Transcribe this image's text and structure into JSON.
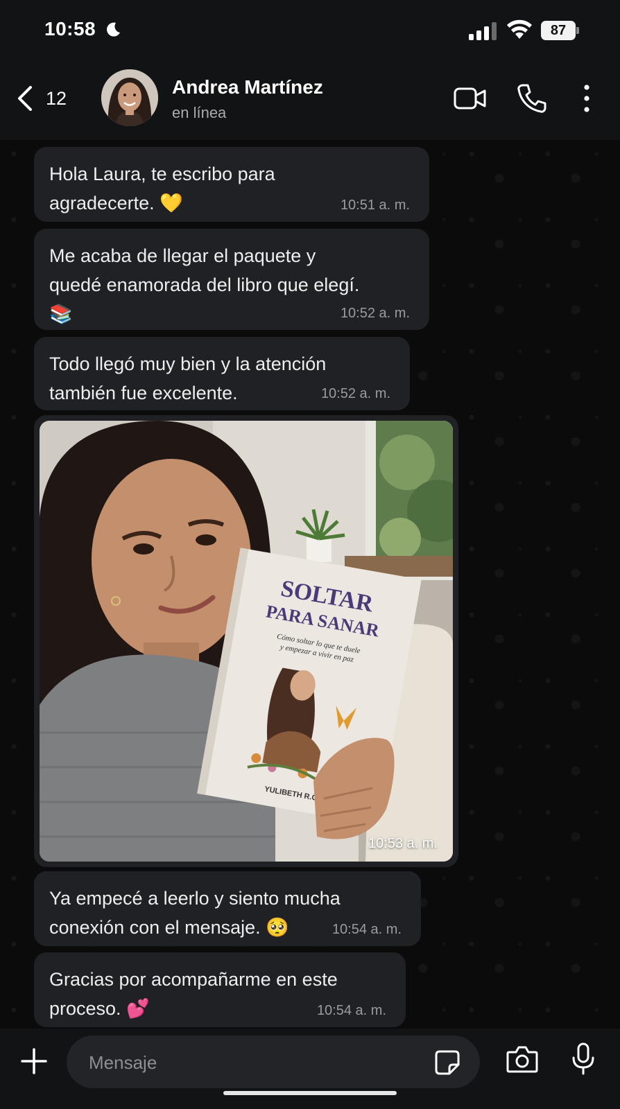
{
  "status_bar": {
    "time": "10:58",
    "battery": "87",
    "icons": [
      "moon-icon",
      "signal-icon",
      "wifi-icon",
      "battery-icon"
    ]
  },
  "header": {
    "back_count": "12",
    "contact_name": "Andrea Martínez",
    "contact_status": "en línea",
    "icons": [
      "chevron-left-icon",
      "video-camera-icon",
      "phone-icon",
      "more-vertical-icon"
    ]
  },
  "messages": [
    {
      "text": "Hola Laura, te escribo para\nagradecerte. 💛",
      "time": "10:51 a. m."
    },
    {
      "text": "Me acaba de llegar el paquete y\nquedé enamorada del libro que elegí.\n📚",
      "time": "10:52 a. m."
    },
    {
      "text": "Todo llegó muy bien y la atención\ntambién fue excelente.",
      "time": "10:52 a. m."
    },
    {
      "text": "Ya empecé a leerlo y siento mucha\nconexión con el mensaje. 🥺",
      "time": "10:54 a. m."
    },
    {
      "text": "Gracias por acompañarme en este\nproceso. 💕",
      "time": "10:54 a. m."
    }
  ],
  "photo_message": {
    "time": "10:53 a. m.",
    "book": {
      "title_line1": "SOLTAR",
      "title_line2": "PARA SANAR",
      "subtitle_line1": "Cómo soltar lo que te duele",
      "subtitle_line2": "y empezar a vivir en paz",
      "author": "YULIBETH R.G."
    }
  },
  "input_bar": {
    "placeholder": "Mensaje",
    "icons": [
      "plus-icon",
      "sticker-icon",
      "camera-icon",
      "microphone-icon"
    ]
  },
  "colors": {
    "background": "#0b0b0c",
    "bar": "#121314",
    "bubble": "#202124",
    "time_text": "#9a9ca1",
    "book_title": "#4a3a78"
  }
}
